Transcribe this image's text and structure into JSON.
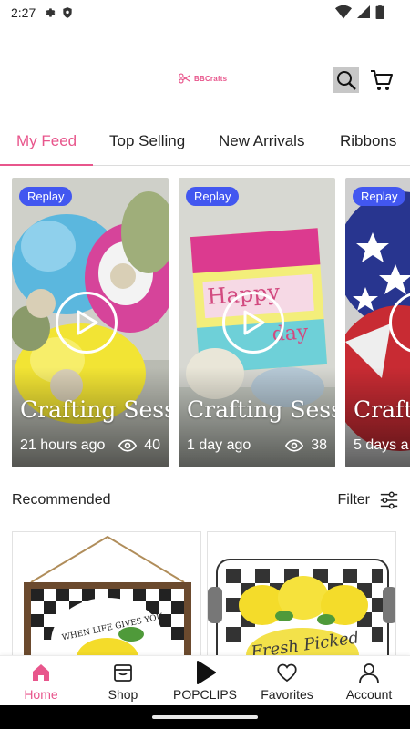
{
  "status_bar": {
    "time": "2:27"
  },
  "header": {
    "logo_text": "BBCrafts"
  },
  "tabs": [
    {
      "label": "My Feed"
    },
    {
      "label": "Top Selling"
    },
    {
      "label": "New Arrivals"
    },
    {
      "label": "Ribbons"
    }
  ],
  "reels": [
    {
      "badge": "Replay",
      "title": "Crafting Sess...",
      "time_ago": "21 hours ago",
      "views": "40"
    },
    {
      "badge": "Replay",
      "title": "Crafting Sess...",
      "time_ago": "1 day ago",
      "views": "38"
    },
    {
      "badge": "Replay",
      "title": "Crafti",
      "time_ago": "5 days a"
    }
  ],
  "recommended": {
    "title": "Recommended",
    "filter_label": "Filter"
  },
  "products": [
    {
      "sign_text": "WHEN LIFE GIVES YOU"
    },
    {
      "sign_text": "Fresh Picked"
    }
  ],
  "bottom_nav": [
    {
      "label": "Home",
      "icon": "home-icon"
    },
    {
      "label": "Shop",
      "icon": "shop-icon"
    },
    {
      "label": "POPCLIPS",
      "icon": "play-icon"
    },
    {
      "label": "Favorites",
      "icon": "heart-icon"
    },
    {
      "label": "Account",
      "icon": "account-icon"
    }
  ],
  "colors": {
    "accent": "#e8568c",
    "badge": "#4257f0"
  }
}
